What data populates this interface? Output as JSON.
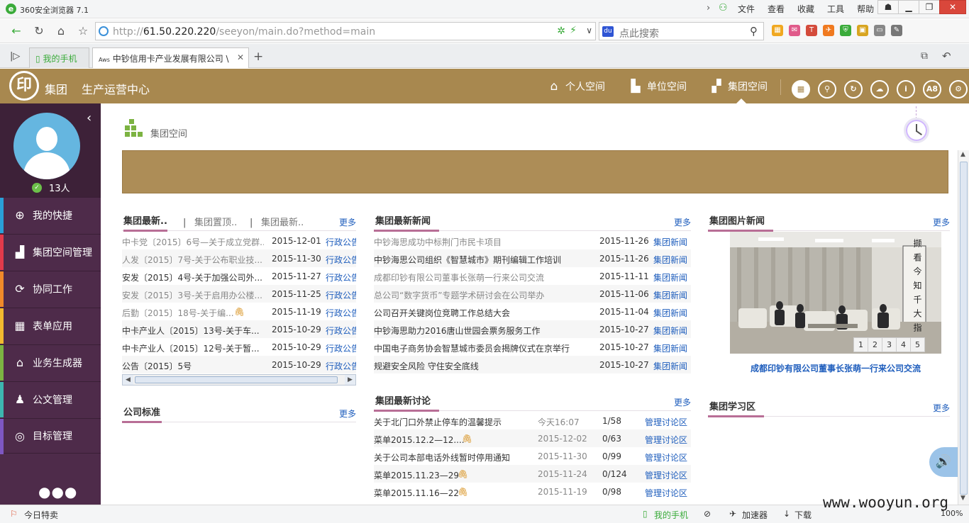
{
  "browser": {
    "app_name": "360安全浏览器 7.1",
    "menu": [
      "文件",
      "查看",
      "收藏",
      "工具",
      "帮助"
    ],
    "url_prefix": "http://",
    "url_host": "61.50.220.220",
    "url_path": "/seeyon/main.do?method=main",
    "search_placeholder": "点此搜索",
    "tabs": [
      {
        "label": "我的手机"
      },
      {
        "label": "中钞信用卡产业发展有限公司 \\"
      }
    ],
    "status_left": "今日特卖",
    "status_items": [
      "我的手机",
      "加速器",
      "下载"
    ],
    "zoom": "100%"
  },
  "header": {
    "logo_char": "印",
    "group": "集团",
    "center": "生产运营中心",
    "spaces": [
      {
        "label": "个人空间",
        "icon": "house-icon"
      },
      {
        "label": "单位空间",
        "icon": "building-icon"
      },
      {
        "label": "集团空间",
        "icon": "group-building-icon"
      }
    ],
    "round_icons": [
      "grid-icon",
      "search-icon",
      "refresh-icon",
      "cloud-icon",
      "info-icon",
      "a8-icon",
      "gear-icon"
    ],
    "a8_text": "A8"
  },
  "sidebar": {
    "online_count": "13人",
    "items": [
      {
        "label": "我的快捷",
        "color": "#2aa0d8",
        "icon": "+"
      },
      {
        "label": "集团空间管理",
        "color": "#e23a4b",
        "icon": "▟"
      },
      {
        "label": "协同工作",
        "color": "#f08a2a",
        "icon": "⟳"
      },
      {
        "label": "表单应用",
        "color": "#f1b92f",
        "icon": "▦"
      },
      {
        "label": "业务生成器",
        "color": "#7cb342",
        "icon": "⌂"
      },
      {
        "label": "公文管理",
        "color": "#3db6b0",
        "icon": "♟"
      },
      {
        "label": "目标管理",
        "color": "#7e57c2",
        "icon": "◎"
      }
    ]
  },
  "page": {
    "title": "集团空间"
  },
  "col1": {
    "tabs": [
      "集团最新..",
      "集团置顶..",
      "集团最新.."
    ],
    "more": "更多",
    "rows": [
      {
        "title": "中卡党〔2015〕6号—关于成立党群...",
        "date": "2015-12-01",
        "cat": "行政公告",
        "read": true
      },
      {
        "title": "人发〔2015〕7号-关于公布职业技...",
        "date": "2015-11-30",
        "cat": "行政公告",
        "read": true
      },
      {
        "title": "安发〔2015〕4号-关于加强公司外...",
        "date": "2015-11-27",
        "cat": "行政公告",
        "read": false
      },
      {
        "title": "安发〔2015〕3号-关于启用办公楼...",
        "date": "2015-11-25",
        "cat": "行政公告",
        "read": true
      },
      {
        "title": "后勤〔2015〕18号-关于编...",
        "date": "2015-11-19",
        "cat": "行政公告",
        "read": true,
        "attach": true
      },
      {
        "title": "中卡产业人〔2015〕13号-关于车...",
        "date": "2015-10-29",
        "cat": "行政公告",
        "read": false
      },
      {
        "title": "中卡产业人〔2015〕12号-关于暂...",
        "date": "2015-10-29",
        "cat": "行政公告",
        "read": false
      },
      {
        "title": "公告〔2015〕5号",
        "date": "2015-10-29",
        "cat": "行政公告",
        "read": false
      }
    ],
    "std_title": "公司标准",
    "std_more": "更多"
  },
  "col2": {
    "news_title": "集团最新新闻",
    "news_more": "更多",
    "news": [
      {
        "title": "中钞海思成功中标荆门市民卡项目",
        "date": "2015-11-26",
        "cat": "集团新闻",
        "read": true
      },
      {
        "title": "中钞海思公司组织《智慧城市》期刊编辑工作培训",
        "date": "2015-11-26",
        "cat": "集团新闻",
        "read": false
      },
      {
        "title": "成都印钞有限公司董事长张萌一行来公司交流",
        "date": "2015-11-11",
        "cat": "集团新闻",
        "read": true
      },
      {
        "title": "总公司“数字货币”专题学术研讨会在公司举办",
        "date": "2015-11-06",
        "cat": "集团新闻",
        "read": true
      },
      {
        "title": "公司召开关键岗位竞聘工作总结大会",
        "date": "2015-11-04",
        "cat": "集团新闻",
        "read": false
      },
      {
        "title": "中钞海思助力2016唐山世园会票务服务工作",
        "date": "2015-10-27",
        "cat": "集团新闻",
        "read": false
      },
      {
        "title": "中国电子商务协会智慧城市委员会揭牌仪式在京举行",
        "date": "2015-10-27",
        "cat": "集团新闻",
        "read": false
      },
      {
        "title": "规避安全风险 守住安全底线",
        "date": "2015-10-27",
        "cat": "集团新闻",
        "read": false
      }
    ],
    "disc_title": "集团最新讨论",
    "disc_more": "更多",
    "discussions": [
      {
        "title": "关于北门口外禁止停车的温馨提示",
        "date": "今天16:07",
        "count": "1/58",
        "cat": "管理讨论区",
        "attach": false
      },
      {
        "title": "菜单2015.12.2—12....",
        "date": "2015-12-02",
        "count": "0/63",
        "cat": "管理讨论区",
        "attach": true
      },
      {
        "title": "关于公司本部电话外线暂时停用通知",
        "date": "2015-11-30",
        "count": "0/99",
        "cat": "管理讨论区",
        "attach": false
      },
      {
        "title": "菜单2015.11.23—29",
        "date": "2015-11-24",
        "count": "0/124",
        "cat": "管理讨论区",
        "attach": true
      },
      {
        "title": "菜单2015.11.16—22",
        "date": "2015-11-19",
        "count": "0/98",
        "cat": "管理讨论区",
        "attach": true
      }
    ]
  },
  "col3": {
    "photo_title": "集团图片新闻",
    "photo_more": "更多",
    "photo_caption": "成都印钞有限公司董事长张萌一行来公司交流",
    "photo_calligraphy": "撷 看 今 知 千 大 指",
    "pager": [
      "1",
      "2",
      "3",
      "4",
      "5"
    ],
    "study_title": "集团学习区",
    "study_more": "更多"
  },
  "watermark": "www.wooyun.org"
}
